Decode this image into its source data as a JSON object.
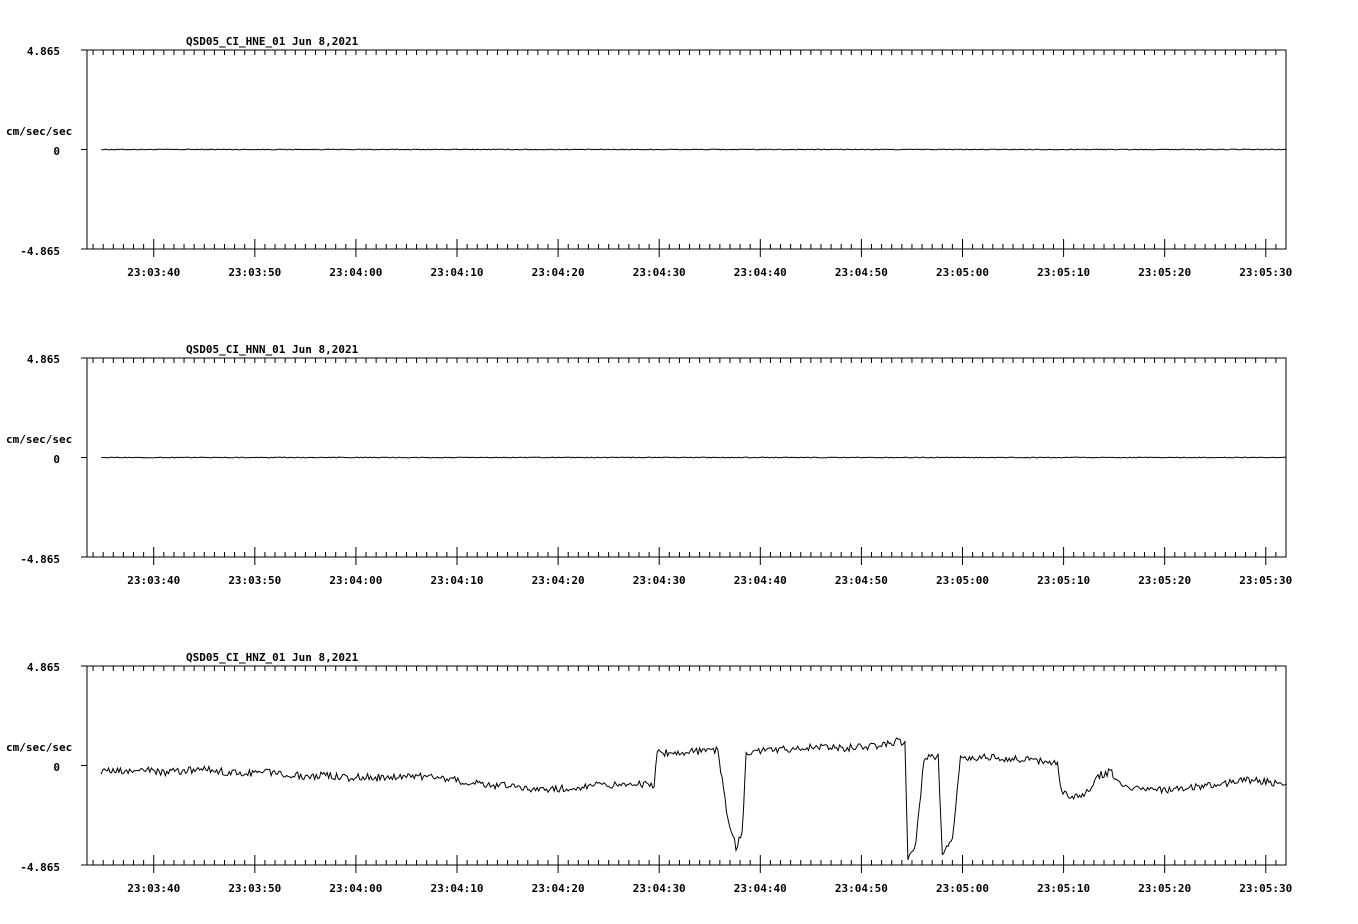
{
  "page": {
    "background": "#ffffff",
    "trace_color": "#000000"
  },
  "chart_data": [
    {
      "type": "line",
      "title": "QSD05_CI_HNE_01  Jun 8,2021",
      "ylabel": "cm/sec/sec",
      "y_ticks": [
        "4.865",
        "0",
        "-4.865"
      ],
      "ylim": [
        -4.865,
        4.865
      ],
      "x_ticks": [
        "23:03:40",
        "23:03:50",
        "23:04:00",
        "23:04:10",
        "23:04:20",
        "23:04:30",
        "23:04:40",
        "23:04:50",
        "23:05:00",
        "23:05:10",
        "23:05:20",
        "23:05:30"
      ],
      "x_range_seconds": [
        -6.6,
        112
      ],
      "grid": false,
      "series": [
        {
          "points": [
            [
              -5.2,
              0.0
            ],
            [
              0,
              0.0
            ],
            [
              10,
              0.0
            ],
            [
              20,
              0.0
            ],
            [
              30,
              0.0
            ],
            [
              40,
              0.0
            ],
            [
              50,
              0.0
            ],
            [
              60,
              0.0
            ],
            [
              70,
              0.0
            ],
            [
              80,
              0.0
            ],
            [
              90,
              0.0
            ],
            [
              100,
              0.0
            ],
            [
              112,
              0.0
            ]
          ]
        }
      ]
    },
    {
      "type": "line",
      "title": "QSD05_CI_HNN_01  Jun 8,2021",
      "ylabel": "cm/sec/sec",
      "y_ticks": [
        "4.865",
        "0",
        "-4.865"
      ],
      "ylim": [
        -4.865,
        4.865
      ],
      "x_ticks": [
        "23:03:40",
        "23:03:50",
        "23:04:00",
        "23:04:10",
        "23:04:20",
        "23:04:30",
        "23:04:40",
        "23:04:50",
        "23:05:00",
        "23:05:10",
        "23:05:20",
        "23:05:30"
      ],
      "x_range_seconds": [
        -6.6,
        112
      ],
      "grid": false,
      "series": [
        {
          "points": [
            [
              -5.2,
              0.0
            ],
            [
              0,
              0.0
            ],
            [
              10,
              0.0
            ],
            [
              20,
              0.0
            ],
            [
              30,
              0.0
            ],
            [
              40,
              0.0
            ],
            [
              50,
              0.0
            ],
            [
              60,
              0.0
            ],
            [
              70,
              0.0
            ],
            [
              80,
              0.0
            ],
            [
              90,
              0.0
            ],
            [
              100,
              0.0
            ],
            [
              112,
              0.0
            ]
          ]
        }
      ]
    },
    {
      "type": "line",
      "title": "QSD05_CI_HNZ_01  Jun 8,2021",
      "ylabel": "cm/sec/sec",
      "y_ticks": [
        "4.865",
        "0",
        "-4.865"
      ],
      "ylim": [
        -4.865,
        4.865
      ],
      "x_ticks": [
        "23:03:40",
        "23:03:50",
        "23:04:00",
        "23:04:10",
        "23:04:20",
        "23:04:30",
        "23:04:40",
        "23:04:50",
        "23:05:00",
        "23:05:10",
        "23:05:20",
        "23:05:30"
      ],
      "x_range_seconds": [
        -6.6,
        112
      ],
      "grid": false,
      "series": [
        {
          "points": [
            [
              -5.2,
              -0.25
            ],
            [
              -3,
              -0.3
            ],
            [
              -1,
              -0.2
            ],
            [
              1,
              -0.35
            ],
            [
              3,
              -0.25
            ],
            [
              5,
              -0.2
            ],
            [
              7,
              -0.3
            ],
            [
              9,
              -0.4
            ],
            [
              11,
              -0.3
            ],
            [
              13,
              -0.4
            ],
            [
              15,
              -0.55
            ],
            [
              17,
              -0.45
            ],
            [
              19,
              -0.6
            ],
            [
              21,
              -0.55
            ],
            [
              23,
              -0.6
            ],
            [
              25,
              -0.5
            ],
            [
              27,
              -0.55
            ],
            [
              29,
              -0.65
            ],
            [
              31,
              -0.8
            ],
            [
              33,
              -0.95
            ],
            [
              35,
              -1.0
            ],
            [
              37,
              -1.1
            ],
            [
              39,
              -1.2
            ],
            [
              41,
              -1.1
            ],
            [
              43,
              -1.0
            ],
            [
              45,
              -0.95
            ],
            [
              47,
              -0.9
            ],
            [
              49.5,
              -0.95
            ],
            [
              49.8,
              0.6
            ],
            [
              52,
              0.65
            ],
            [
              54,
              0.7
            ],
            [
              55.8,
              0.75
            ],
            [
              56.8,
              -2.6
            ],
            [
              57.6,
              -4.0
            ],
            [
              58.2,
              -3.3
            ],
            [
              58.6,
              0.6
            ],
            [
              60,
              0.7
            ],
            [
              62,
              0.8
            ],
            [
              64,
              0.85
            ],
            [
              66,
              0.9
            ],
            [
              68,
              0.85
            ],
            [
              70,
              0.9
            ],
            [
              72,
              1.0
            ],
            [
              73.5,
              1.2
            ],
            [
              74.3,
              1.0
            ],
            [
              74.6,
              -4.6
            ],
            [
              75.4,
              -3.8
            ],
            [
              76.2,
              0.4
            ],
            [
              77.6,
              0.4
            ],
            [
              78.0,
              -4.3
            ],
            [
              79.0,
              -3.5
            ],
            [
              79.8,
              0.35
            ],
            [
              82,
              0.4
            ],
            [
              84,
              0.35
            ],
            [
              86,
              0.3
            ],
            [
              88,
              0.2
            ],
            [
              89.4,
              0.1
            ],
            [
              89.8,
              -1.4
            ],
            [
              91,
              -1.5
            ],
            [
              92.6,
              -1.3
            ],
            [
              93.4,
              -0.5
            ],
            [
              94.6,
              -0.3
            ],
            [
              96,
              -1.0
            ],
            [
              98,
              -1.1
            ],
            [
              100,
              -1.2
            ],
            [
              102,
              -1.1
            ],
            [
              104,
              -1.0
            ],
            [
              106,
              -0.9
            ],
            [
              108,
              -0.7
            ],
            [
              110,
              -0.8
            ],
            [
              112,
              -0.9
            ]
          ]
        }
      ]
    }
  ]
}
